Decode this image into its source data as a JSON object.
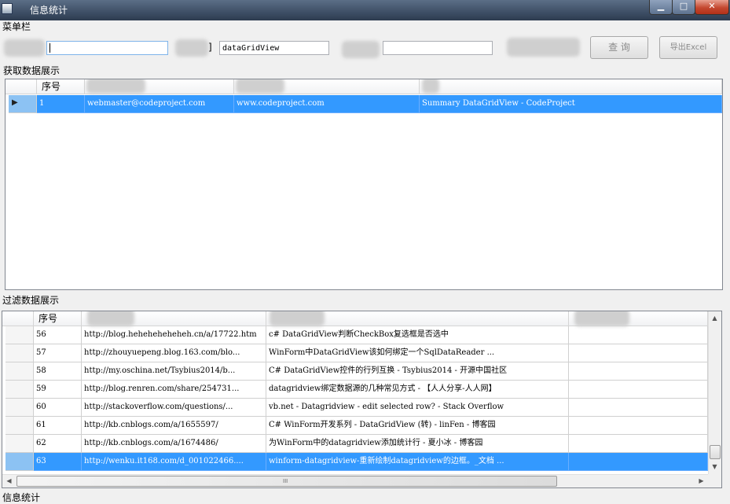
{
  "window": {
    "title": "信息统计"
  },
  "menu": {
    "label": "菜单栏",
    "field_a_value": "",
    "field_b_value": "dataGridView",
    "field_b_label_tail": "]",
    "field_c_value": "",
    "query_button": "查 询",
    "export_button": "导出Excel"
  },
  "top_section": {
    "label": "获取数据展示",
    "headers": [
      "序号",
      "",
      "",
      ""
    ],
    "rows": [
      {
        "cells": [
          "1",
          "webmaster@codeproject.com",
          "www.codeproject.com",
          "Summary DataGridView - CodeProject"
        ],
        "selected": true
      }
    ]
  },
  "bottom_section": {
    "label": "过滤数据展示",
    "headers": [
      "序号",
      "",
      "",
      ""
    ],
    "rows": [
      {
        "cells": [
          "56",
          "http://blog.heheheheheheh.cn/a/17722.htm",
          "c# DataGridView判断CheckBox复选框是否选中",
          ""
        ],
        "selected": false
      },
      {
        "cells": [
          "57",
          "http://zhouyuepeng.blog.163.com/blo...",
          "WinForm中DataGridView该如何绑定一个SqlDataReader ...",
          ""
        ],
        "selected": false
      },
      {
        "cells": [
          "58",
          "http://my.oschina.net/Tsybius2014/b...",
          "C# DataGridView控件的行列互换 - Tsybius2014 - 开源中国社区",
          ""
        ],
        "selected": false
      },
      {
        "cells": [
          "59",
          "http://blog.renren.com/share/254731...",
          "datagridview绑定数据源的几种常见方式 - 【人人分享-人人网】",
          ""
        ],
        "selected": false
      },
      {
        "cells": [
          "60",
          "http://stackoverflow.com/questions/...",
          "vb.net - Datagridview - edit selected row? - Stack Overflow",
          ""
        ],
        "selected": false
      },
      {
        "cells": [
          "61",
          "http://kb.cnblogs.com/a/1655597/",
          "C# WinForm开发系列 - DataGridView (转) - linFen - 博客园",
          ""
        ],
        "selected": false
      },
      {
        "cells": [
          "62",
          "http://kb.cnblogs.com/a/1674486/",
          "为WinForm中的datagridview添加统计行 - 夏小冰 - 博客园",
          ""
        ],
        "selected": false
      },
      {
        "cells": [
          "63",
          "http://wenku.it168.com/d_001022466....",
          "winform-datagridview-重新绘制datagridview的边框。_文档 ...",
          ""
        ],
        "selected": true
      }
    ],
    "scroll_grip": "III"
  },
  "status": {
    "label": "信息统计"
  },
  "icons": {
    "minimize": "minimize-icon",
    "maximize": "maximize-icon",
    "close": "close-icon",
    "row_pointer": "row-pointer-icon"
  },
  "colors": {
    "selection": "#3399ff",
    "titlebar": "#3e4f66",
    "close": "#c4482f"
  }
}
